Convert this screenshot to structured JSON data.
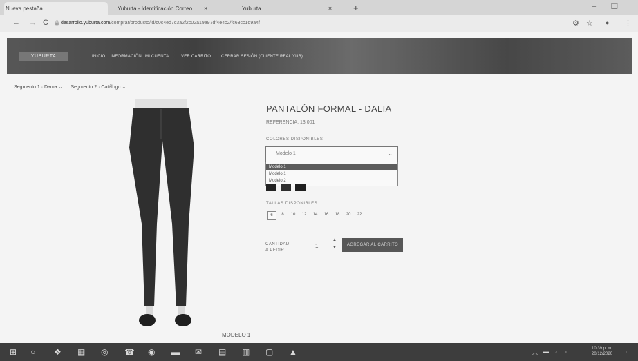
{
  "browser": {
    "tabs": [
      {
        "label": "Nueva pestaña",
        "close": "×"
      },
      {
        "label": "Yuburta - Identificación Correo...",
        "close": "×"
      },
      {
        "label": "Yuburta",
        "close": "×"
      }
    ],
    "new_tab": "+",
    "window_controls": {
      "minimize": "–",
      "maximize": "❐"
    },
    "url_host": "desarrollo.yuburta.com",
    "url_path": "/comprar/producto/id/c0c4ed7c3a2f2c02a19a97df4e4c2/fc63cc1d9a4f",
    "nav": {
      "back": "←",
      "forward": "→",
      "reload": "C",
      "lock": "🔒"
    },
    "tools": {
      "extensions": "⚙",
      "star": "☆",
      "profile": "●",
      "menu": "⋮"
    }
  },
  "site": {
    "logo": "YUBURTA",
    "menu": [
      "INICIO",
      "INFORMACIÓN",
      "MI CUENTA",
      "VER CARRITO",
      "CERRAR SESIÓN (CLIENTE REAL YUB)"
    ]
  },
  "breadcrumb": [
    "Segmento 1 · Dama ⌄",
    "Segmento 2 · Catálogo ⌄"
  ],
  "product": {
    "title": "PANTALÓN FORMAL - DALIA",
    "reference": "REFERENCIA: 13 001",
    "color_label": "COLORES DISPONIBLES",
    "selected_option": "Modelo 1",
    "dropdown_options": [
      "Modelo 1",
      "Modelo 1",
      "Modelo 2"
    ],
    "sizes_label": "TALLAS DISPONIBLES",
    "sizes": [
      "6",
      "8",
      "10",
      "12",
      "14",
      "16",
      "18",
      "20",
      "22"
    ],
    "qty_label": "CANTIDAD A PEDIR",
    "qty_value": "1",
    "qty_up": "▲",
    "qty_down": "▼",
    "add_button": "AGREGAR AL CARRITO",
    "model_label": "MODELO 1",
    "swatch_colors": [
      "#1e1e1e",
      "#2a2a2a",
      "#1a1a1a"
    ]
  },
  "taskbar": {
    "clock_time": "10:39 p. m.",
    "clock_date": "20/12/2020"
  }
}
